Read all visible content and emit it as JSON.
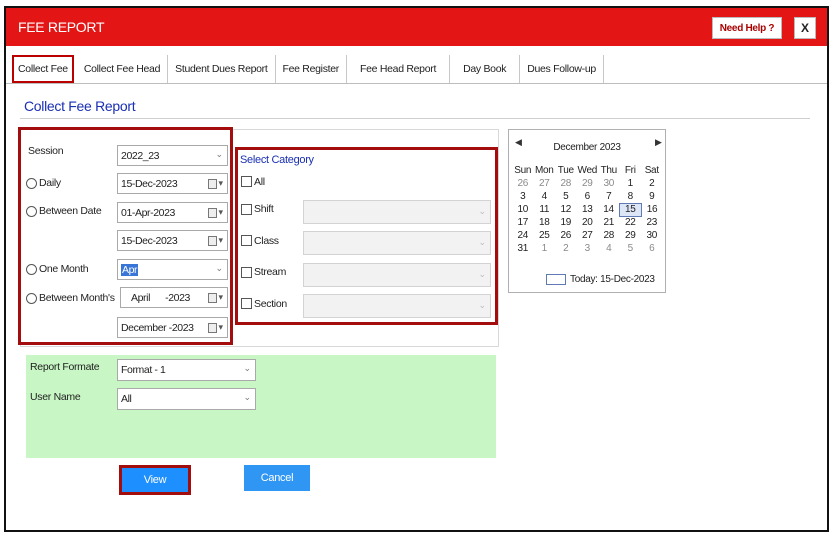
{
  "window": {
    "title": "FEE REPORT",
    "help_label": "Need Help ?",
    "close_label": "X"
  },
  "tabs": [
    {
      "label": "Collect Fee",
      "active": true
    },
    {
      "label": "Collect Fee Head"
    },
    {
      "label": "Student Dues Report"
    },
    {
      "label": "Fee Register"
    },
    {
      "label": "Fee Head Report"
    },
    {
      "label": "Day Book"
    },
    {
      "label": "Dues Follow-up"
    }
  ],
  "page_title": "Collect Fee Report",
  "period": {
    "session_label": "Session",
    "session_value": "2022_23",
    "daily_label": "Daily",
    "daily_date": "15-Dec-2023",
    "between_date_label": "Between Date",
    "between_from": "01-Apr-2023",
    "between_to": "15-Dec-2023",
    "one_month_label": "One Month",
    "one_month_value": "Apr",
    "between_months_label": "Between Month's",
    "month_from": "April      -2023",
    "month_to": "December -2023"
  },
  "category": {
    "title": "Select Category",
    "all_label": "All",
    "shift_label": "Shift",
    "class_label": "Class",
    "stream_label": "Stream",
    "section_label": "Section"
  },
  "options": {
    "format_label": "Report Formate",
    "format_value": "Format - 1",
    "user_label": "User Name",
    "user_value": "All"
  },
  "buttons": {
    "view": "View",
    "cancel": "Cancel"
  },
  "calendar": {
    "month_title": "December 2023",
    "weekdays": [
      "Sun",
      "Mon",
      "Tue",
      "Wed",
      "Thu",
      "Fri",
      "Sat"
    ],
    "weeks": [
      [
        "26",
        "27",
        "28",
        "29",
        "30",
        "1",
        "2"
      ],
      [
        "3",
        "4",
        "5",
        "6",
        "7",
        "8",
        "9"
      ],
      [
        "10",
        "11",
        "12",
        "13",
        "14",
        "15",
        "16"
      ],
      [
        "17",
        "18",
        "19",
        "20",
        "21",
        "22",
        "23"
      ],
      [
        "24",
        "25",
        "26",
        "27",
        "28",
        "29",
        "30"
      ],
      [
        "31",
        "1",
        "2",
        "3",
        "4",
        "5",
        "6"
      ]
    ],
    "today_text": "Today: 15-Dec-2023",
    "prev_icon": "caret-left-icon",
    "next_icon": "caret-right-icon"
  },
  "colors": {
    "titlebar": "#e41515",
    "accent_blue": "#1a2fb3",
    "highlight_red": "#a30d0d",
    "green_panel": "#c8f7c5",
    "button_blue": "#1e8fff"
  }
}
